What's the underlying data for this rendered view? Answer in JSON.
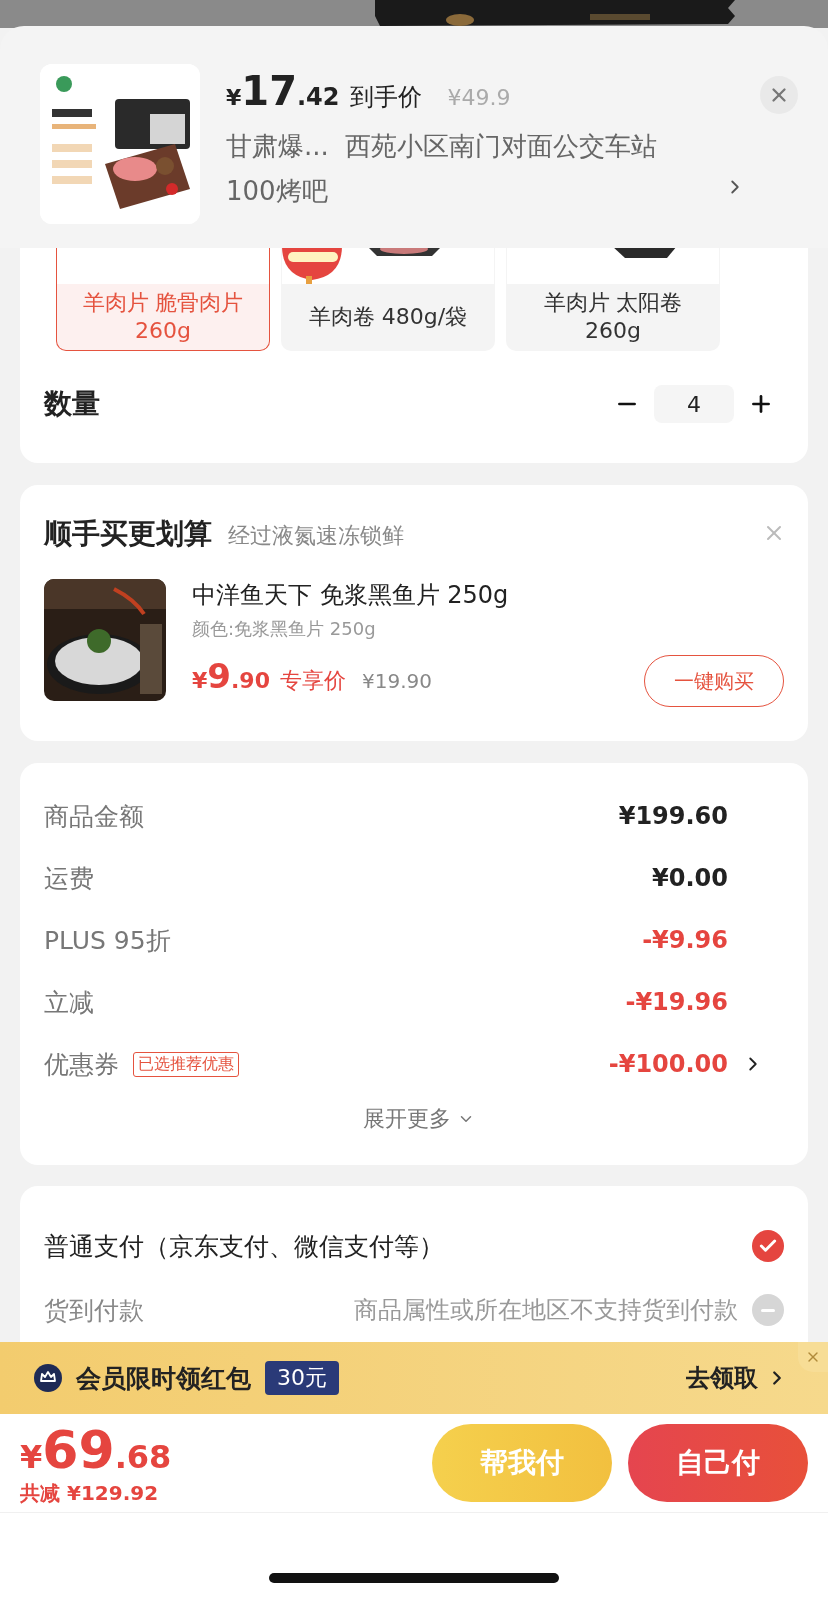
{
  "header": {
    "currency": "¥",
    "price_int": "17",
    "price_dec": ".42",
    "price_label": "到手价",
    "original_price": "¥49.9",
    "recipient": "甘肃爆...",
    "address": "西苑小区南门对面公交车站100烤吧"
  },
  "options": [
    {
      "lines": [
        "羊肉片 脆骨肉片",
        "260g"
      ],
      "selected": true
    },
    {
      "lines": [
        "羊肉卷 480g/袋"
      ],
      "selected": false
    },
    {
      "lines": [
        "羊肉片 太阳卷",
        "260g"
      ],
      "selected": false
    }
  ],
  "quantity": {
    "label": "数量",
    "value": "4"
  },
  "addon": {
    "title": "顺手买更划算",
    "subtitle": "经过液氮速冻锁鲜",
    "name": "中洋鱼天下 免浆黑鱼片 250g",
    "spec": "颜色:免浆黑鱼片 250g",
    "currency": "¥",
    "price_int": "9",
    "price_dec": ".90",
    "price_label": "专享价",
    "original_price": "¥19.90",
    "button": "一键购买"
  },
  "summary": {
    "rows": [
      {
        "label": "商品金额",
        "value": "¥199.60",
        "highlight": false
      },
      {
        "label": "运费",
        "value": "¥0.00",
        "highlight": false
      },
      {
        "label": "PLUS 95折",
        "value": "-¥9.96",
        "highlight": true
      },
      {
        "label": "立减",
        "value": "-¥19.96",
        "highlight": true
      },
      {
        "label": "优惠券",
        "tag": "已选推荐优惠",
        "value": "-¥100.00",
        "highlight": true,
        "link": true
      }
    ],
    "expand": "展开更多"
  },
  "payment": [
    {
      "label": "普通支付（京东支付、微信支付等）",
      "selected": true,
      "disabled": false
    },
    {
      "label": "货到付款",
      "note": "商品属性或所在地区不支持货到付款",
      "selected": false,
      "disabled": true
    }
  ],
  "banner": {
    "text": "会员限时领红包",
    "badge": "30元",
    "action": "去领取"
  },
  "footer": {
    "currency": "¥",
    "total_int": "69",
    "total_dec": ".68",
    "saving": "共减 ¥129.92",
    "buttons": [
      {
        "label": "帮我付",
        "kind": "secondary"
      },
      {
        "label": "自己付",
        "kind": "primary"
      }
    ]
  }
}
